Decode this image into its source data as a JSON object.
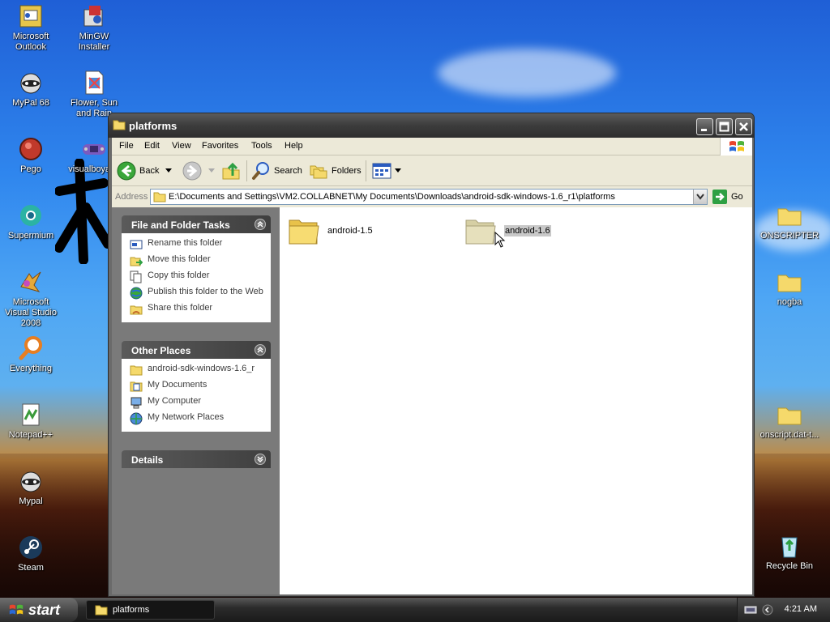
{
  "desktop": {
    "icons_left": [
      {
        "label": "Microsoft Outlook",
        "icon": "outlook-icon"
      },
      {
        "label": "MinGW Installer",
        "icon": "installer-icon"
      },
      {
        "label": "MyPal 68",
        "icon": "mypal-icon"
      },
      {
        "label": "Flower, Sun and Rain",
        "icon": "document-icon"
      },
      {
        "label": "Pego",
        "icon": "pego-icon"
      },
      {
        "label": "visualboyadv",
        "icon": "gameboy-icon"
      },
      {
        "label": "Supermium",
        "icon": "supermium-icon"
      },
      {
        "label": "Microsoft Visual Studio 2008",
        "icon": "visual-studio-icon"
      },
      {
        "label": "Everything",
        "icon": "search-icon"
      },
      {
        "label": "Notepad++",
        "icon": "notepad-icon"
      },
      {
        "label": "Mypal",
        "icon": "mypal-icon"
      },
      {
        "label": "Steam",
        "icon": "steam-icon"
      }
    ],
    "icons_right": [
      {
        "label": "ONSCRIPTER",
        "icon": "folder-icon"
      },
      {
        "label": "nogba",
        "icon": "folder-icon"
      },
      {
        "label": "onscript.dat-t...",
        "icon": "folder-icon"
      },
      {
        "label": "Recycle Bin",
        "icon": "recycle-bin-icon"
      }
    ]
  },
  "window": {
    "title": "platforms",
    "menu": [
      "File",
      "Edit",
      "View",
      "Favorites",
      "Tools",
      "Help"
    ],
    "toolbar": {
      "back": "Back",
      "search": "Search",
      "folders": "Folders"
    },
    "address": {
      "label": "Address",
      "path": "E:\\Documents and Settings\\VM2.COLLABNET\\My Documents\\Downloads\\android-sdk-windows-1.6_r1\\platforms",
      "go": "Go"
    },
    "file_tasks": {
      "title": "File and Folder Tasks",
      "items": [
        "Rename this folder",
        "Move this folder",
        "Copy this folder",
        "Publish this folder to the Web",
        "Share this folder"
      ]
    },
    "other_places": {
      "title": "Other Places",
      "items": [
        "android-sdk-windows-1.6_r",
        "My Documents",
        "My Computer",
        "My Network Places"
      ]
    },
    "details": {
      "title": "Details"
    },
    "files": [
      {
        "name": "android-1.5",
        "selected": false
      },
      {
        "name": "android-1.6",
        "selected": true
      }
    ]
  },
  "taskbar": {
    "start": "start",
    "task": "platforms",
    "clock": "4:21 AM"
  },
  "colors": {
    "folder": "#f5d96b",
    "selection": "#c8c8c8",
    "accent_green": "#2ea043"
  }
}
